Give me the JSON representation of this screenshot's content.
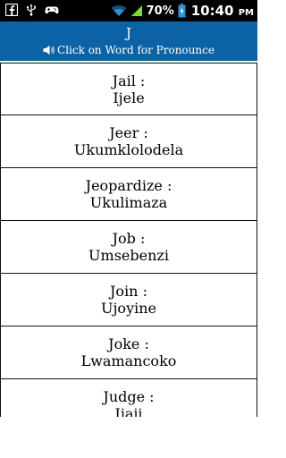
{
  "status_bar": {
    "battery_percent": "70%",
    "time": "10:40",
    "time_suffix": "PM",
    "icons": [
      "facebook-icon",
      "usb-icon",
      "gamepad-icon",
      "wifi-icon",
      "signal-icon",
      "battery-icon"
    ]
  },
  "header": {
    "title": "J",
    "subtitle": "Click on Word for Pronounce",
    "subtitle_icon": "speaker-icon",
    "background": "#0b63a5"
  },
  "words": [
    {
      "english": "Jail :",
      "zulu": "Ijele"
    },
    {
      "english": "Jeer :",
      "zulu": "Ukumklolodela"
    },
    {
      "english": "Jeopardize :",
      "zulu": "Ukulimaza"
    },
    {
      "english": "Job :",
      "zulu": "Umsebenzi"
    },
    {
      "english": "Join :",
      "zulu": "Ujoyine"
    },
    {
      "english": "Joke :",
      "zulu": "Lwamancoko"
    },
    {
      "english": "Judge :",
      "zulu": "Ijaji"
    }
  ]
}
